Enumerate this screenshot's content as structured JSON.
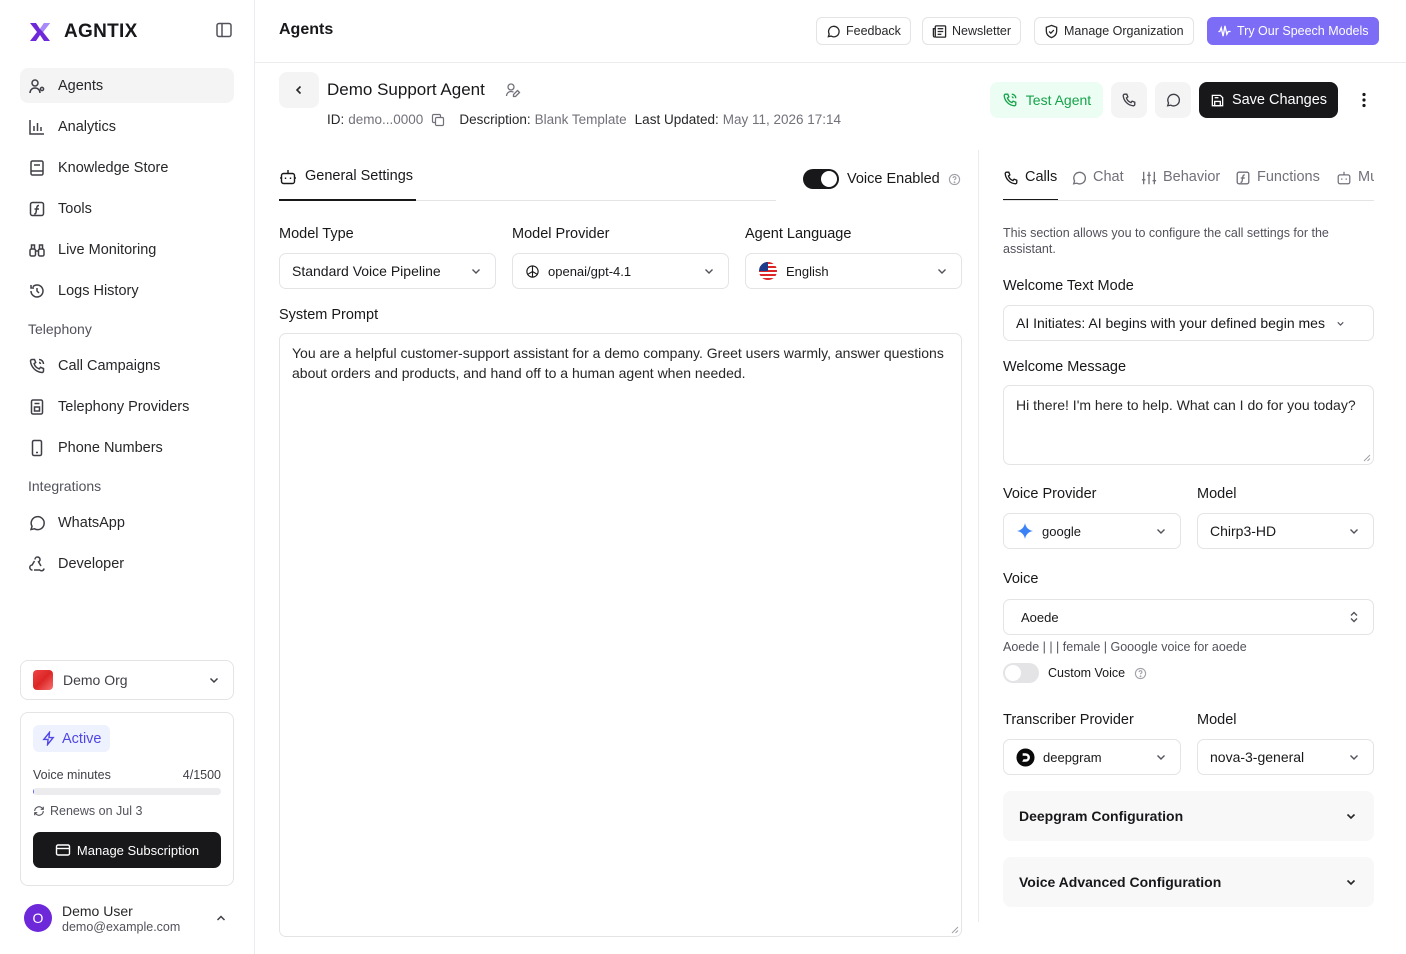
{
  "sidebar": {
    "brand": "AGNTIX",
    "nav": [
      {
        "label": "Agents",
        "icon": "agents-icon",
        "active": true
      },
      {
        "label": "Analytics",
        "icon": "bar-chart-icon"
      },
      {
        "label": "Knowledge Store",
        "icon": "book-icon"
      },
      {
        "label": "Tools",
        "icon": "function-icon"
      },
      {
        "label": "Live Monitoring",
        "icon": "binoculars-icon"
      },
      {
        "label": "Logs History",
        "icon": "history-icon"
      }
    ],
    "telephony_title": "Telephony",
    "telephony": [
      {
        "label": "Call Campaigns",
        "icon": "phone-call-icon"
      },
      {
        "label": "Telephony Providers",
        "icon": "building-icon"
      },
      {
        "label": "Phone Numbers",
        "icon": "smartphone-icon"
      }
    ],
    "integrations_title": "Integrations",
    "integrations": [
      {
        "label": "WhatsApp",
        "icon": "message-circle-icon"
      },
      {
        "label": "Developer",
        "icon": "webhook-icon"
      }
    ],
    "org": "Demo Org",
    "subscription": {
      "status": "Active",
      "voice_minutes_label": "Voice minutes",
      "voice_minutes_value": "4/1500",
      "usage_fraction": 0.0027,
      "renews": "Renews on Jul 3",
      "manage_label": "Manage Subscription"
    },
    "user": {
      "initial": "O",
      "name": "Demo User",
      "email": "demo@example.com"
    }
  },
  "topbar": {
    "title": "Agents",
    "buttons": {
      "feedback": "Feedback",
      "newsletter": "Newsletter",
      "manage_org": "Manage Organization",
      "speech": "Try Our Speech Models"
    }
  },
  "agent": {
    "name": "Demo Support Agent",
    "id_label": "ID:",
    "id_value": "demo...0000",
    "desc_label": "Description:",
    "desc_value": "Blank Template",
    "updated_label": "Last Updated:",
    "updated_value": "May 11, 2026 17:14",
    "test_label": "Test Agent",
    "save_label": "Save Changes"
  },
  "general": {
    "tab": "General Settings",
    "voice_enabled": "Voice Enabled",
    "model_type_label": "Model Type",
    "model_type_value": "Standard Voice Pipeline",
    "model_provider_label": "Model Provider",
    "model_provider_value": "openai/gpt-4.1",
    "language_label": "Agent Language",
    "language_value": "English",
    "system_prompt_label": "System Prompt",
    "system_prompt_value": "You are a helpful customer-support assistant for a demo company. Greet users warmly, answer questions about orders and products, and hand off to a human agent when needed."
  },
  "right": {
    "tabs": [
      {
        "label": "Calls",
        "icon": "phone-icon",
        "active": true
      },
      {
        "label": "Chat",
        "icon": "message-circle-icon"
      },
      {
        "label": "Behavior",
        "icon": "sliders-icon"
      },
      {
        "label": "Functions",
        "icon": "function-icon"
      },
      {
        "label": "Mu",
        "icon": "robot-icon"
      }
    ],
    "description": "This section allows you to configure the call settings for the assistant.",
    "welcome_mode_label": "Welcome Text Mode",
    "welcome_mode_value": "AI Initiates: AI begins with your defined begin mes",
    "welcome_msg_label": "Welcome Message",
    "welcome_msg_value": "Hi there! I'm here to help. What can I do for you today?",
    "voice_provider_label": "Voice Provider",
    "voice_provider_value": "google",
    "voice_model_label": "Model",
    "voice_model_value": "Chirp3-HD",
    "voice_label": "Voice",
    "voice_value": "Aoede",
    "voice_info": "Aoede | | | female | Gooogle voice for aoede",
    "custom_voice": "Custom Voice",
    "transcriber_label": "Transcriber Provider",
    "transcriber_value": "deepgram",
    "transcriber_model_label": "Model",
    "transcriber_model_value": "nova-3-general",
    "deepgram_config": "Deepgram Configuration",
    "voice_advanced": "Voice Advanced Configuration"
  },
  "colors": {
    "accent": "#7c6cf6",
    "success": "#16a34a",
    "dark": "#18181b"
  }
}
